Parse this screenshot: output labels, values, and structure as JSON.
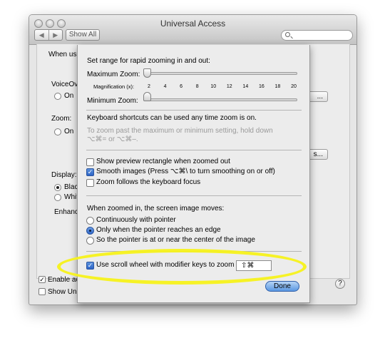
{
  "window": {
    "title": "Universal Access",
    "nav_back": "◀",
    "nav_forward": "▶",
    "show_all_label": "Show All",
    "search_placeholder": ""
  },
  "background": {
    "when_using_label": "When usi",
    "voiceover_label": "VoiceOv",
    "voiceover_on_label": "On",
    "zoom_label": "Zoom:",
    "zoom_on_label": "On",
    "display_label": "Display:",
    "display_option1": "Black",
    "display_option2": "Whit",
    "enhance_label": "Enhanc",
    "button1_label": "...",
    "button2_label": "s...",
    "enable_access_label": "Enable ac",
    "enable_access_checked": true,
    "show_universal_label": "Show Uni",
    "show_universal_checked": false,
    "help_label": "?"
  },
  "sheet": {
    "range_heading": "Set range for rapid zooming in and out:",
    "maximum_zoom_label": "Maximum Zoom:",
    "magnification_label": "Magnification (x):",
    "magnification_ticks": [
      "2",
      "4",
      "6",
      "8",
      "10",
      "12",
      "14",
      "16",
      "18",
      "20"
    ],
    "minimum_zoom_label": "Minimum Zoom:",
    "maximum_zoom_value": 1,
    "minimum_zoom_value": 1,
    "shortcuts_text": "Keyboard shortcuts can be used any time zoom is on.",
    "hint_line1": "To zoom past the maximum or minimum setting, hold down",
    "hint_line2": "⌥⌘= or ⌥⌘–.",
    "options": [
      {
        "label": "Show preview rectangle when zoomed out",
        "checked": false
      },
      {
        "label": "Smooth images (Press ⌥⌘\\ to turn smoothing on or off)",
        "checked": true
      },
      {
        "label": "Zoom follows the keyboard focus",
        "checked": false
      }
    ],
    "moves_heading": "When zoomed in, the screen image moves:",
    "move_options": [
      {
        "label": "Continuously with pointer",
        "selected": false
      },
      {
        "label": "Only when the pointer reaches an edge",
        "selected": true
      },
      {
        "label": "So the pointer is at or near the center of the image",
        "selected": false
      }
    ],
    "scroll_wheel_label": "Use scroll wheel with modifier keys to zoom",
    "scroll_wheel_checked": true,
    "modifier_keys_value": "⇧⌘",
    "done_label": "Done"
  },
  "colors": {
    "highlight": "#f7f21b",
    "accent": "#3a73d0"
  }
}
